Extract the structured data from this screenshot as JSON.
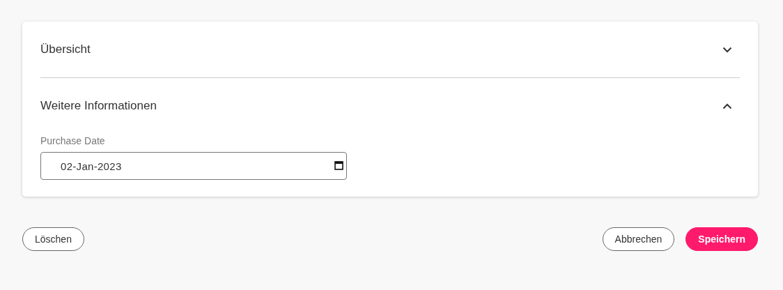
{
  "sections": [
    {
      "title": "Übersicht",
      "expanded": false
    },
    {
      "title": "Weitere Informationen",
      "expanded": true,
      "fields": [
        {
          "label": "Purchase Date",
          "value": "02-Jan-2023",
          "kind": "date"
        }
      ]
    }
  ],
  "footer": {
    "left": [
      {
        "label": "Löschen",
        "kind": "outline"
      }
    ],
    "right": [
      {
        "label": "Abbrechen",
        "kind": "outline"
      },
      {
        "label": "Speichern",
        "kind": "filled"
      }
    ]
  }
}
